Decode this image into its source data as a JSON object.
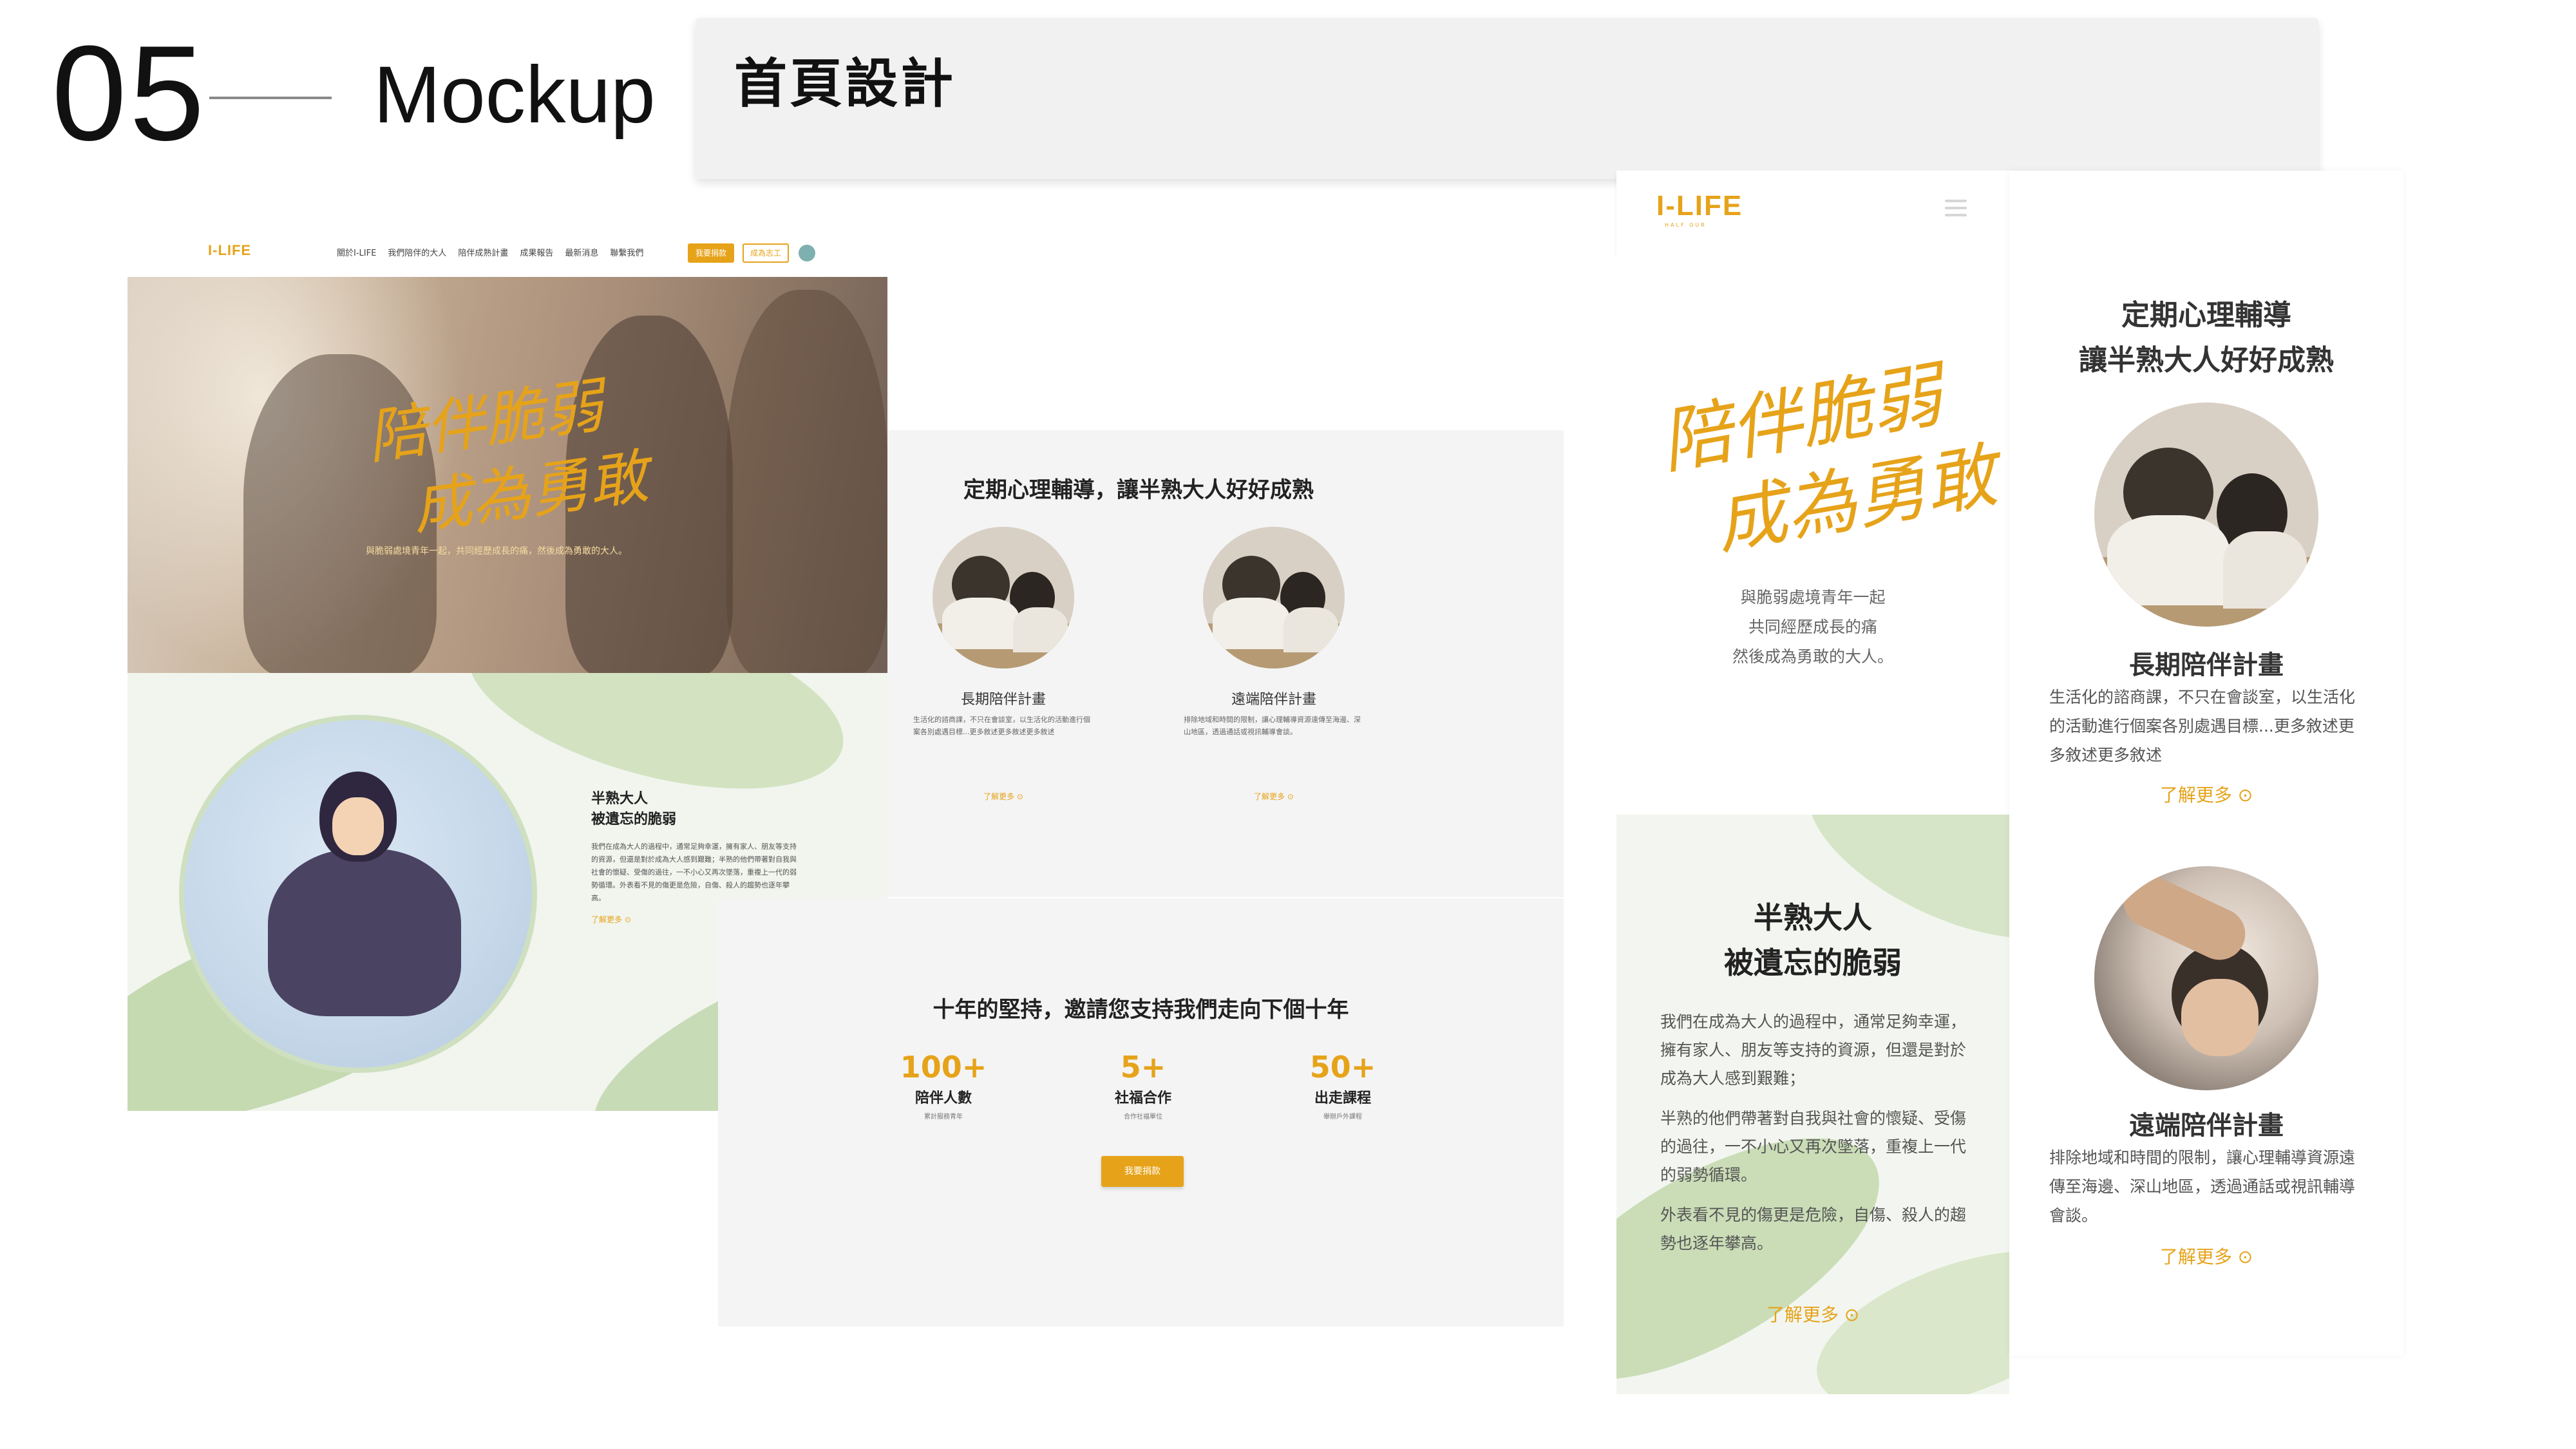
{
  "slide": {
    "number": "05",
    "title": "Mockup",
    "section_label": "首頁設計"
  },
  "desktop": {
    "logo": "I-LIFE",
    "nav": [
      "關於I-LIFE",
      "我們陪伴的大人",
      "陪伴成熟計畫",
      "成果報告",
      "最新消息",
      "聯繫我們"
    ],
    "nav_button_primary": "我要捐款",
    "nav_button_secondary": "成為志工",
    "hero": {
      "script_line1": "陪伴脆弱",
      "script_line2": "成為勇敢",
      "caption": "與脆弱處境青年一起，共同經歷成長的痛，然後成為勇敢的大人。"
    },
    "story": {
      "title_line1": "半熟大人",
      "title_line2": "被遺忘的脆弱",
      "body": "我們在成為大人的過程中，通常足夠幸運，擁有家人、朋友等支持的資源，但還是對於成為大人感到艱難；半熟的他們帶著對自我與社會的懷疑、受傷的過往，一不小心又再次墜落，重複上一代的弱勢循環。外表看不見的傷更是危險，自傷、殺人的趨勢也逐年攀高。",
      "more": "了解更多 ⊙"
    },
    "services": {
      "heading": "定期心理輔導，讓半熟大人好好成熟",
      "items": [
        {
          "title": "長期陪伴計畫",
          "body": "生活化的諮商課，不只在會談室，以生活化的活動進行個案各別處遇目標...更多敘述更多敘述更多敘述",
          "more": "了解更多 ⊙"
        },
        {
          "title": "遠端陪伴計畫",
          "body": "排除地域和時間的限制，讓心理輔導資源遠傳至海邊、深山地區，透過通話或視訊輔導會談。",
          "more": "了解更多 ⊙"
        }
      ]
    },
    "stats": {
      "heading": "十年的堅持，邀請您支持我們走向下個十年",
      "items": [
        {
          "number": "100+",
          "label": "陪伴人數",
          "sub": "累計服務青年"
        },
        {
          "number": "5+",
          "label": "社福合作",
          "sub": "合作社福單位"
        },
        {
          "number": "50+",
          "label": "出走課程",
          "sub": "舉辦戶外課程"
        }
      ],
      "button": "我要捐款"
    }
  },
  "mobile": {
    "logo": "I-LIFE",
    "logo_sub": "HALF OUR",
    "hero": {
      "script_line1": "陪伴脆弱",
      "script_line2": "成為勇敢",
      "lines": [
        "與脆弱處境青年一起",
        "共同經歷成長的痛",
        "然後成為勇敢的大人。"
      ]
    },
    "story": {
      "title_line1": "半熟大人",
      "title_line2": "被遺忘的脆弱",
      "p1": "我們在成為大人的過程中，通常足夠幸運，擁有家人、朋友等支持的資源，但還是對於成為大人感到艱難；",
      "p2": "半熟的他們帶著對自我與社會的懷疑、受傷的過往，一不小心又再次墜落，重複上一代的弱勢循環。",
      "p3": "外表看不見的傷更是危險，自傷、殺人的趨勢也逐年攀高。",
      "more": "了解更多 ⊙"
    },
    "services": {
      "heading_line1": "定期心理輔導",
      "heading_line2": "讓半熟大人好好成熟",
      "items": [
        {
          "title": "長期陪伴計畫",
          "body": "生活化的諮商課，不只在會談室，以生活化的活動進行個案各別處遇目標...更多敘述更多敘述更多敘述",
          "more": "了解更多 ⊙"
        },
        {
          "title": "遠端陪伴計畫",
          "body": "排除地域和時間的限制，讓心理輔導資源遠傳至海邊、深山地區，透過通話或視訊輔導會談。",
          "more": "了解更多 ⊙"
        }
      ]
    }
  },
  "colors": {
    "accent": "#e6a31a",
    "panel": "#f4f4f4",
    "text": "#222222"
  }
}
